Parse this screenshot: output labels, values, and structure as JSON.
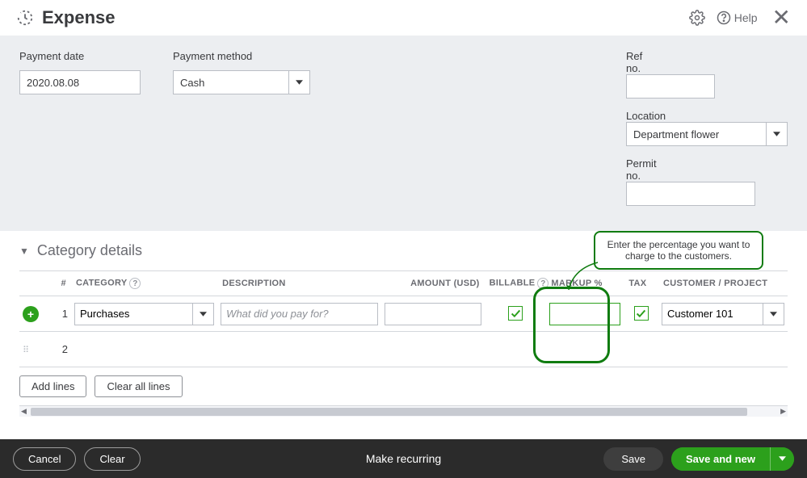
{
  "header": {
    "title": "Expense",
    "help_label": "Help"
  },
  "form": {
    "payment_date_label": "Payment date",
    "payment_date_value": "2020.08.08",
    "payment_method_label": "Payment method",
    "payment_method_value": "Cash",
    "ref_no_label": "Ref no.",
    "ref_no_value": "",
    "location_label": "Location",
    "location_value": "Department flower",
    "permit_no_label": "Permit no.",
    "permit_no_value": ""
  },
  "section": {
    "title": "Category details"
  },
  "columns": {
    "num": "#",
    "category": "CATEGORY",
    "description": "DESCRIPTION",
    "amount": "AMOUNT (USD)",
    "billable": "BILLABLE",
    "markup": "MARKUP %",
    "tax": "TAX",
    "customer": "CUSTOMER / PROJECT"
  },
  "rows": [
    {
      "num": "1",
      "category": "Purchases",
      "description_placeholder": "What did you pay for?",
      "description": "",
      "amount": "",
      "billable": true,
      "markup": "",
      "tax": true,
      "customer": "Customer 101"
    },
    {
      "num": "2",
      "category": "",
      "description_placeholder": "",
      "description": "",
      "amount": "",
      "billable": false,
      "markup": "",
      "tax": false,
      "customer": ""
    }
  ],
  "grid_buttons": {
    "add_lines": "Add lines",
    "clear_all": "Clear all lines"
  },
  "callout": {
    "text": "Enter the percentage you want to charge to the customers."
  },
  "footer": {
    "cancel": "Cancel",
    "clear": "Clear",
    "make_recurring": "Make recurring",
    "save": "Save",
    "save_and_new": "Save and new"
  }
}
